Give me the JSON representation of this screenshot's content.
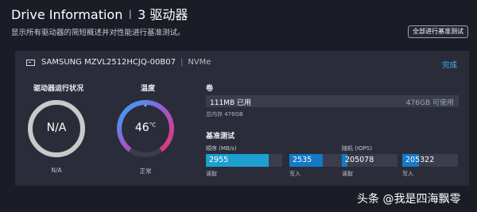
{
  "header": {
    "title": "Drive Information",
    "divider": "I",
    "subtitle": "3 驱动器",
    "description": "显示所有驱动器的简短概述并对性能进行基准测试。",
    "bench_all_label": "全部进行基准测试"
  },
  "drive": {
    "icon": "drive-icon",
    "name": "SAMSUNG MZVL2512HCJQ-00B07",
    "divider": "|",
    "type": "NVMe",
    "done_label": "完成",
    "health": {
      "label": "驱动器运行状况",
      "value": "N/A",
      "status": "N/A"
    },
    "temperature": {
      "label": "温度",
      "value": "46",
      "unit": "°C",
      "status": "正常",
      "level": 0.46
    },
    "volume": {
      "label": "卷",
      "used": "111MB 已用",
      "available": "476GB 可使用",
      "total": "总内存 476GB",
      "used_fraction": 0.0002
    },
    "benchmark": {
      "label": "基准测试",
      "sequential": {
        "label": "顺序 (MB/s)",
        "read": "2955",
        "write": "2535",
        "read_fraction": 0.82,
        "write_fraction": 0.6
      },
      "random": {
        "label": "随机 (IOPS)",
        "read": "205078",
        "write": "205322",
        "read_fraction": 0.1,
        "write_fraction": 0.3
      },
      "read_caption": "读取",
      "write_caption": "写入"
    }
  },
  "watermark": "头条 @我是四海飘零",
  "colors": {
    "background": "#1b1d26",
    "panel": "#2a2d39",
    "accent": "#4fb1ff",
    "bar_fill": "#1479c6"
  }
}
